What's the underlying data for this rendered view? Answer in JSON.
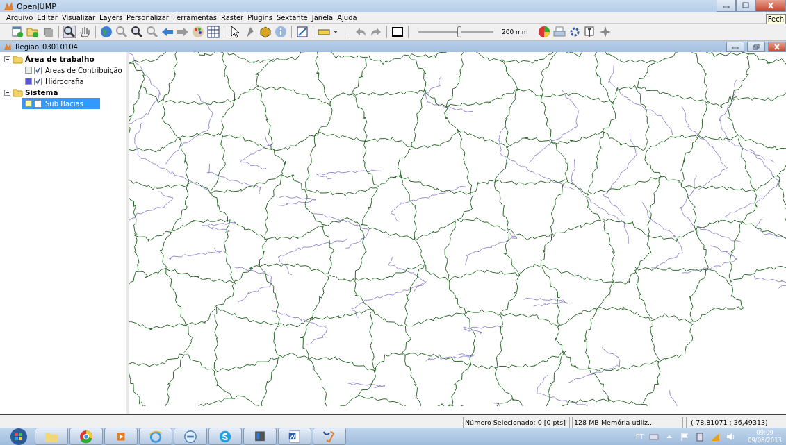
{
  "window": {
    "title": "OpenJUMP",
    "tooltip": "Fech"
  },
  "menu": [
    "Arquivo",
    "Editar",
    "Visualizar",
    "Layers",
    "Personalizar",
    "Ferramentas",
    "Raster",
    "Plugins",
    "Sextante",
    "Janela",
    "Ajuda"
  ],
  "toolbar": {
    "scale_slider": {
      "level": 0.55
    },
    "scale": "200 mm"
  },
  "document": {
    "title": "Regiao_03010104"
  },
  "layer_tree": [
    {
      "label": "Área de trabalho",
      "expanded": true,
      "children": [
        {
          "label": "Areas de Contribuição",
          "checked": true,
          "selected": false,
          "color": "#e6efe6"
        },
        {
          "label": "Hidrografia",
          "checked": true,
          "selected": false,
          "color": "#5555dd"
        }
      ]
    },
    {
      "label": "Sistema",
      "expanded": true,
      "children": [
        {
          "label": "Sub Bacias",
          "checked": false,
          "selected": true,
          "color": "#ffff99"
        }
      ]
    }
  ],
  "status_bar": [
    "Número Selecionado: 0 [0 pts]",
    "128 MB Memória utiliz...",
    "(-78,81071 ; 36,49313)"
  ],
  "taskbar": {
    "language": "PT",
    "time": "09:09",
    "date": "09/08/2013"
  }
}
